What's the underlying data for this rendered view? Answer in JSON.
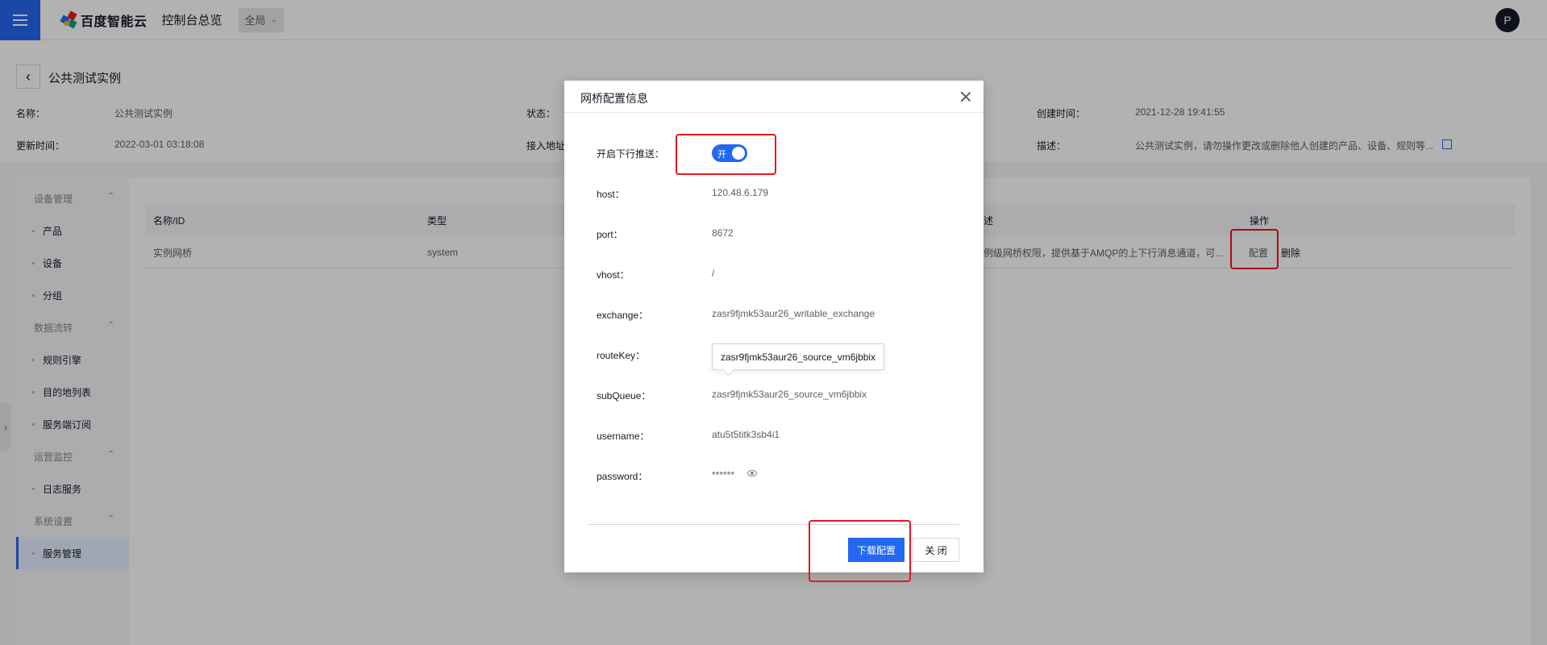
{
  "topbar": {
    "logo_text": "百度智能云",
    "title": "控制台总览",
    "region": "全局",
    "avatar_initial": "P"
  },
  "header": {
    "page_title": "公共测试实例",
    "name_label": "名称：",
    "name_value": "公共测试实例",
    "status_label": "状态：",
    "created_label": "创建时间：",
    "created_value": "2021-12-28 19:41:55",
    "updated_label": "更新时间：",
    "updated_value": "2022-03-01 03:18:08",
    "access_label": "接入地址",
    "desc_label": "描述：",
    "desc_value": "公共测试实例，请勿操作更改或删除他人创建的产品、设备、规则等..."
  },
  "sidebar": {
    "groups": [
      {
        "label": "设备管理",
        "items": [
          "产品",
          "设备",
          "分组"
        ]
      },
      {
        "label": "数据流转",
        "items": [
          "规则引擎",
          "目的地列表",
          "服务端订阅"
        ]
      },
      {
        "label": "运营监控",
        "items": [
          "日志服务"
        ]
      },
      {
        "label": "系统设置",
        "items": [
          "服务管理"
        ]
      }
    ],
    "active_item": "服务管理"
  },
  "table": {
    "headers": [
      "名称/ID",
      "类型",
      "述",
      "操作"
    ],
    "rows": [
      {
        "name": "实例网桥",
        "type": "system",
        "desc": "例级网桥权限，提供基于AMQP的上下行消息通道，可...",
        "action_config": "配置",
        "action_delete": "删除"
      }
    ]
  },
  "dialog": {
    "title": "网桥配置信息",
    "fields": {
      "push_label": "开启下行推送：",
      "switch_text": "开",
      "switch_on": true,
      "host_label": "host：",
      "host_value": "120.48.6.179",
      "port_label": "port：",
      "port_value": "8672",
      "vhost_label": "vhost：",
      "vhost_value": "/",
      "exchange_label": "exchange：",
      "exchange_value": "zasr9fjmk53aur26_writable_exchange",
      "routekey_label": "routeKey：",
      "routekey_tooltip": "zasr9fjmk53aur26_source_vm6jbbix",
      "subqueue_label": "subQueue：",
      "subqueue_value": "zasr9fjmk53aur26_source_vm6jbbix",
      "username_label": "username：",
      "username_value": "atu5t5titk3sb4i1",
      "password_label": "password：",
      "password_value": "******"
    },
    "download_button": "下载配置",
    "close_button": "关 闭"
  },
  "colors": {
    "primary": "#2468f2",
    "highlight": "#f0131e"
  }
}
